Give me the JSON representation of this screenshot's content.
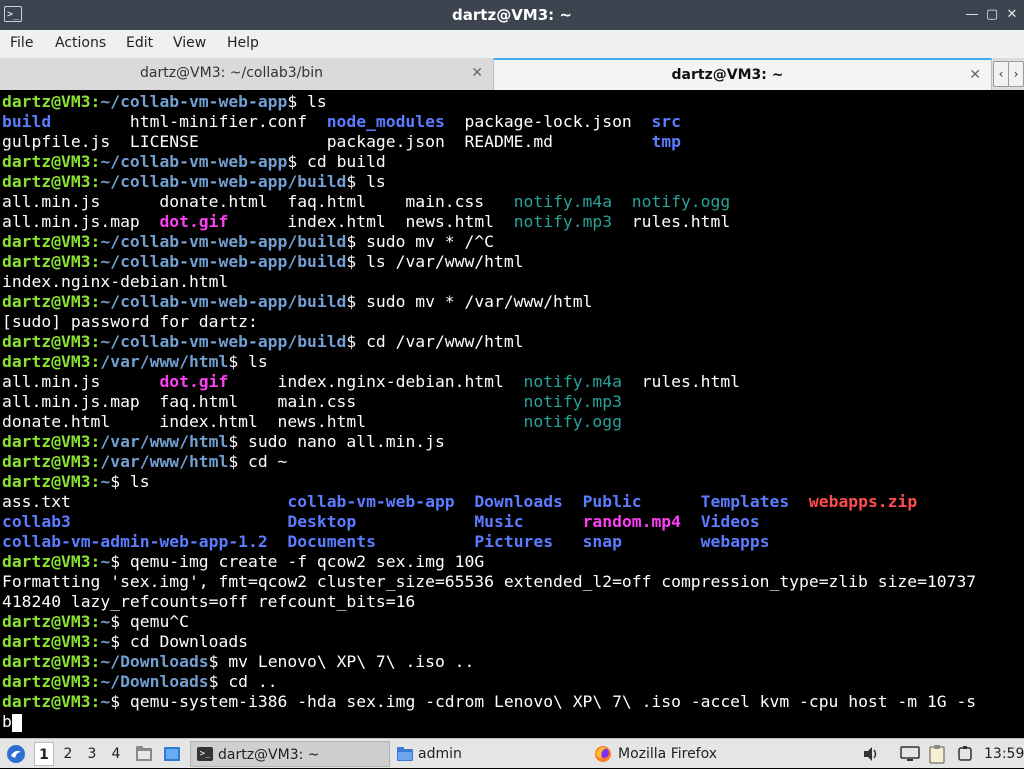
{
  "window": {
    "title": "dartz@VM3: ~",
    "icon": "terminal-icon",
    "buttons": [
      {
        "name": "minimize-icon",
        "glyph": "—"
      },
      {
        "name": "maximize-icon",
        "glyph": "▢"
      },
      {
        "name": "close-icon",
        "glyph": "✕"
      }
    ]
  },
  "menu": [
    "File",
    "Actions",
    "Edit",
    "View",
    "Help"
  ],
  "tabs": [
    {
      "label": "dartz@VM3: ~/collab3/bin",
      "active": false
    },
    {
      "label": "dartz@VM3: ~",
      "active": true
    }
  ],
  "tab_scroll": {
    "left": "‹",
    "right": "›"
  },
  "colors": {
    "prompt_user": "#8ae234",
    "prompt_path": "#729fcf",
    "directory": "#5c7cff",
    "media": "#2aa198",
    "image": "#ff3df5",
    "archive": "#ff4d4d",
    "active_tab_accent": "#3daee9"
  },
  "terminal": {
    "lines": [
      [
        {
          "t": "dartz@VM3:",
          "c": "p-user"
        },
        {
          "t": "~/collab-vm-web-app",
          "c": "p-path"
        },
        {
          "t": "$ ls"
        }
      ],
      [
        {
          "t": "build",
          "c": "c-dir"
        },
        {
          "t": "        html-minifier.conf  "
        },
        {
          "t": "node_modules",
          "c": "c-dir"
        },
        {
          "t": "  package-lock.json  "
        },
        {
          "t": "src",
          "c": "c-dir"
        }
      ],
      [
        {
          "t": "gulpfile.js  LICENSE             package.json  README.md          "
        },
        {
          "t": "tmp",
          "c": "c-dir"
        }
      ],
      [
        {
          "t": "dartz@VM3:",
          "c": "p-user"
        },
        {
          "t": "~/collab-vm-web-app",
          "c": "p-path"
        },
        {
          "t": "$ cd build"
        }
      ],
      [
        {
          "t": "dartz@VM3:",
          "c": "p-user"
        },
        {
          "t": "~/collab-vm-web-app/build",
          "c": "p-path"
        },
        {
          "t": "$ ls"
        }
      ],
      [
        {
          "t": "all.min.js      donate.html  faq.html    main.css   "
        },
        {
          "t": "notify.m4a",
          "c": "c-media"
        },
        {
          "t": "  "
        },
        {
          "t": "notify.ogg",
          "c": "c-media"
        }
      ],
      [
        {
          "t": "all.min.js.map  "
        },
        {
          "t": "dot.gif",
          "c": "c-img"
        },
        {
          "t": "      index.html  news.html  "
        },
        {
          "t": "notify.mp3",
          "c": "c-media"
        },
        {
          "t": "  rules.html"
        }
      ],
      [
        {
          "t": "dartz@VM3:",
          "c": "p-user"
        },
        {
          "t": "~/collab-vm-web-app/build",
          "c": "p-path"
        },
        {
          "t": "$ sudo mv * /^C"
        }
      ],
      [
        {
          "t": "dartz@VM3:",
          "c": "p-user"
        },
        {
          "t": "~/collab-vm-web-app/build",
          "c": "p-path"
        },
        {
          "t": "$ ls /var/www/html"
        }
      ],
      [
        {
          "t": "index.nginx-debian.html"
        }
      ],
      [
        {
          "t": "dartz@VM3:",
          "c": "p-user"
        },
        {
          "t": "~/collab-vm-web-app/build",
          "c": "p-path"
        },
        {
          "t": "$ sudo mv * /var/www/html"
        }
      ],
      [
        {
          "t": "[sudo] password for dartz:"
        }
      ],
      [
        {
          "t": "dartz@VM3:",
          "c": "p-user"
        },
        {
          "t": "~/collab-vm-web-app/build",
          "c": "p-path"
        },
        {
          "t": "$ cd /var/www/html"
        }
      ],
      [
        {
          "t": "dartz@VM3:",
          "c": "p-user"
        },
        {
          "t": "/var/www/html",
          "c": "p-path"
        },
        {
          "t": "$ ls"
        }
      ],
      [
        {
          "t": "all.min.js      "
        },
        {
          "t": "dot.gif",
          "c": "c-img"
        },
        {
          "t": "     index.nginx-debian.html  "
        },
        {
          "t": "notify.m4a",
          "c": "c-media"
        },
        {
          "t": "  rules.html"
        }
      ],
      [
        {
          "t": "all.min.js.map  faq.html    main.css                 "
        },
        {
          "t": "notify.mp3",
          "c": "c-media"
        }
      ],
      [
        {
          "t": "donate.html     index.html  news.html                "
        },
        {
          "t": "notify.ogg",
          "c": "c-media"
        }
      ],
      [
        {
          "t": "dartz@VM3:",
          "c": "p-user"
        },
        {
          "t": "/var/www/html",
          "c": "p-path"
        },
        {
          "t": "$ sudo nano all.min.js"
        }
      ],
      [
        {
          "t": "dartz@VM3:",
          "c": "p-user"
        },
        {
          "t": "/var/www/html",
          "c": "p-path"
        },
        {
          "t": "$ cd ~"
        }
      ],
      [
        {
          "t": "dartz@VM3:",
          "c": "p-user"
        },
        {
          "t": "~",
          "c": "p-path"
        },
        {
          "t": "$ ls"
        }
      ],
      [
        {
          "t": "ass.txt                      "
        },
        {
          "t": "collab-vm-web-app",
          "c": "c-dir"
        },
        {
          "t": "  "
        },
        {
          "t": "Downloads",
          "c": "c-dir"
        },
        {
          "t": "  "
        },
        {
          "t": "Public",
          "c": "c-dir"
        },
        {
          "t": "      "
        },
        {
          "t": "Templates",
          "c": "c-dir"
        },
        {
          "t": "  "
        },
        {
          "t": "webapps.zip",
          "c": "c-arch"
        }
      ],
      [
        {
          "t": "collab3",
          "c": "c-dir"
        },
        {
          "t": "                      "
        },
        {
          "t": "Desktop",
          "c": "c-dir"
        },
        {
          "t": "            "
        },
        {
          "t": "Music",
          "c": "c-dir"
        },
        {
          "t": "      "
        },
        {
          "t": "random.mp4",
          "c": "c-img"
        },
        {
          "t": "  "
        },
        {
          "t": "Videos",
          "c": "c-dir"
        }
      ],
      [
        {
          "t": "collab-vm-admin-web-app-1.2",
          "c": "c-dir"
        },
        {
          "t": "  "
        },
        {
          "t": "Documents",
          "c": "c-dir"
        },
        {
          "t": "          "
        },
        {
          "t": "Pictures",
          "c": "c-dir"
        },
        {
          "t": "   "
        },
        {
          "t": "snap",
          "c": "c-dir"
        },
        {
          "t": "        "
        },
        {
          "t": "webapps",
          "c": "c-dir"
        }
      ],
      [
        {
          "t": "dartz@VM3:",
          "c": "p-user"
        },
        {
          "t": "~",
          "c": "p-path"
        },
        {
          "t": "$ qemu-img create -f qcow2 sex.img 10G"
        }
      ],
      [
        {
          "t": "Formatting 'sex.img', fmt=qcow2 cluster_size=65536 extended_l2=off compression_type=zlib size=10737"
        }
      ],
      [
        {
          "t": "418240 lazy_refcounts=off refcount_bits=16"
        }
      ],
      [
        {
          "t": "dartz@VM3:",
          "c": "p-user"
        },
        {
          "t": "~",
          "c": "p-path"
        },
        {
          "t": "$ qemu^C"
        }
      ],
      [
        {
          "t": "dartz@VM3:",
          "c": "p-user"
        },
        {
          "t": "~",
          "c": "p-path"
        },
        {
          "t": "$ cd Downloads"
        }
      ],
      [
        {
          "t": "dartz@VM3:",
          "c": "p-user"
        },
        {
          "t": "~/Downloads",
          "c": "p-path"
        },
        {
          "t": "$ mv Lenovo\\ XP\\ 7\\ .iso .."
        }
      ],
      [
        {
          "t": "dartz@VM3:",
          "c": "p-user"
        },
        {
          "t": "~/Downloads",
          "c": "p-path"
        },
        {
          "t": "$ cd .."
        }
      ],
      [
        {
          "t": "dartz@VM3:",
          "c": "p-user"
        },
        {
          "t": "~",
          "c": "p-path"
        },
        {
          "t": "$ qemu-system-i386 -hda sex.img -cdrom Lenovo\\ XP\\ 7\\ .iso -accel kvm -cpu host -m 1G -s"
        }
      ],
      [
        {
          "t": "b"
        }
      ]
    ]
  },
  "taskbar": {
    "menu_icon": "app-menu-icon",
    "workspaces": [
      {
        "label": "1",
        "active": true
      },
      {
        "label": "2",
        "active": false
      },
      {
        "label": "3",
        "active": false
      },
      {
        "label": "4",
        "active": false
      }
    ],
    "launchers": [
      {
        "name": "file-manager-icon"
      },
      {
        "name": "show-desktop-icon"
      }
    ],
    "tasks": [
      {
        "label": "dartz@VM3: ~",
        "icon": "terminal-icon",
        "active": true
      },
      {
        "label": "admin",
        "icon": "folder-icon",
        "active": false
      },
      {
        "label": "Mozilla Firefox",
        "icon": "firefox-icon",
        "active": false
      }
    ],
    "tray": [
      "volume-icon",
      "display-icon",
      "clipboard-icon",
      "power-icon"
    ],
    "clock": "13:59"
  }
}
